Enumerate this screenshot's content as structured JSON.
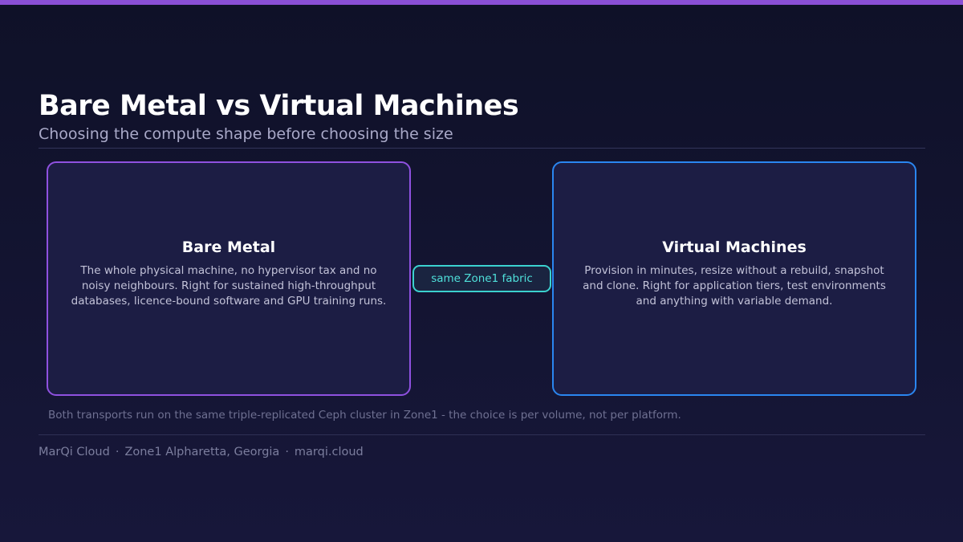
{
  "slide": {
    "title": "Bare Metal vs Virtual Machines",
    "subtitle": "Choosing the compute shape before choosing the size"
  },
  "cards": [
    {
      "title": "Bare Metal",
      "text": "The whole physical machine, no hypervisor tax and no noisy neighbours. Right for sustained high-throughput databases, licence-bound software and GPU training runs."
    },
    {
      "title": "Virtual Machines",
      "text": "Provision in minutes, resize without a rebuild, snapshot and clone. Right for application tiers, test environments and anything with variable demand."
    }
  ],
  "connector": {
    "label": "same Zone1 fabric"
  },
  "footnote": "Both transports run on the same triple-replicated Ceph cluster in Zone1 - the choice is per volume, not per platform.",
  "footer": {
    "brand": "MarQi Cloud",
    "location": "Zone1 Alpharetta, Georgia",
    "url": "marqi.cloud",
    "separator": "·"
  },
  "colors": {
    "accent_purple": "#8f51e0",
    "accent_blue": "#2a86f0",
    "accent_teal": "#3bd1cf",
    "background": "#13142f"
  }
}
